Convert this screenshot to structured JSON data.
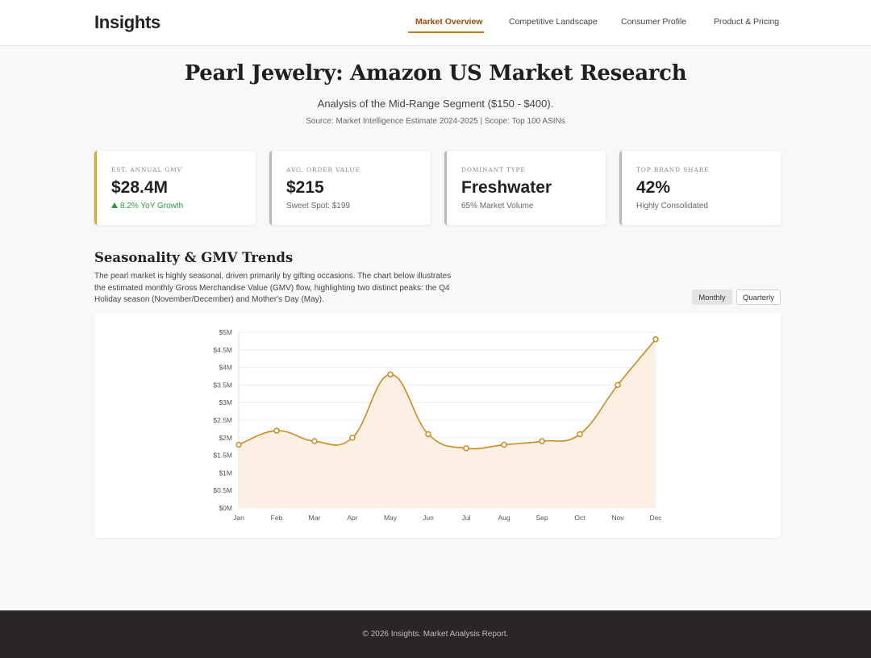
{
  "header": {
    "brand": "Insights",
    "nav": [
      {
        "label": "Market Overview",
        "active": true
      },
      {
        "label": "Competitive Landscape",
        "active": false
      },
      {
        "label": "Consumer Profile",
        "active": false
      },
      {
        "label": "Product & Pricing",
        "active": false
      }
    ],
    "accent_color": "#c8761a"
  },
  "hero": {
    "title": "Pearl Jewelry: Amazon US Market Research",
    "subtitle": "Analysis of the Mid-Range Segment ($150 - $400).",
    "source": "Source: Market Intelligence Estimate 2024-2025 | Scope: Top 100 ASINs"
  },
  "kpis": [
    {
      "label": "Est. Annual GMV",
      "value": "$28.4M",
      "note": "8.2% YoY Growth",
      "trend": "up"
    },
    {
      "label": "Avg. Order Value",
      "value": "$215",
      "note": "Sweet Spot: $199"
    },
    {
      "label": "Dominant Type",
      "value": "Freshwater",
      "note": "65% Market Volume"
    },
    {
      "label": "Top Brand Share",
      "value": "42%",
      "note": "Highly Consolidated"
    }
  ],
  "section": {
    "title": "Seasonality & GMV Trends",
    "description": "The pearl market is highly seasonal, driven primarily by gifting occasions. The chart below illustrates the estimated monthly Gross Merchandise Value (GMV) flow, highlighting two distinct peaks: the Q4 Holiday season (November/December) and Mother's Day (May).",
    "toggles": [
      {
        "label": "Monthly",
        "active": true
      },
      {
        "label": "Quarterly",
        "active": false
      }
    ]
  },
  "chart_data": {
    "type": "area",
    "categories": [
      "Jan",
      "Feb",
      "Mar",
      "Apr",
      "May",
      "Jun",
      "Jul",
      "Aug",
      "Sep",
      "Oct",
      "Nov",
      "Dec"
    ],
    "values": [
      1.8,
      2.2,
      1.9,
      2.0,
      3.8,
      2.1,
      1.7,
      1.8,
      1.9,
      2.1,
      3.5,
      4.8
    ],
    "ylim": [
      0,
      5
    ],
    "yticks": [
      0,
      0.5,
      1,
      1.5,
      2,
      2.5,
      3,
      3.5,
      4,
      4.5,
      5
    ],
    "ytick_labels": [
      "$0M",
      "$0.5M",
      "$1M",
      "$1.5M",
      "$2M",
      "$2.5M",
      "$3M",
      "$3.5M",
      "$4M",
      "$4.5M",
      "$5M"
    ],
    "line_color": "#d08a1e",
    "fill_color": "#fbeee0",
    "grid": true,
    "legend": false
  },
  "footer": {
    "text": "© 2026 Insights. Market Analysis Report."
  }
}
